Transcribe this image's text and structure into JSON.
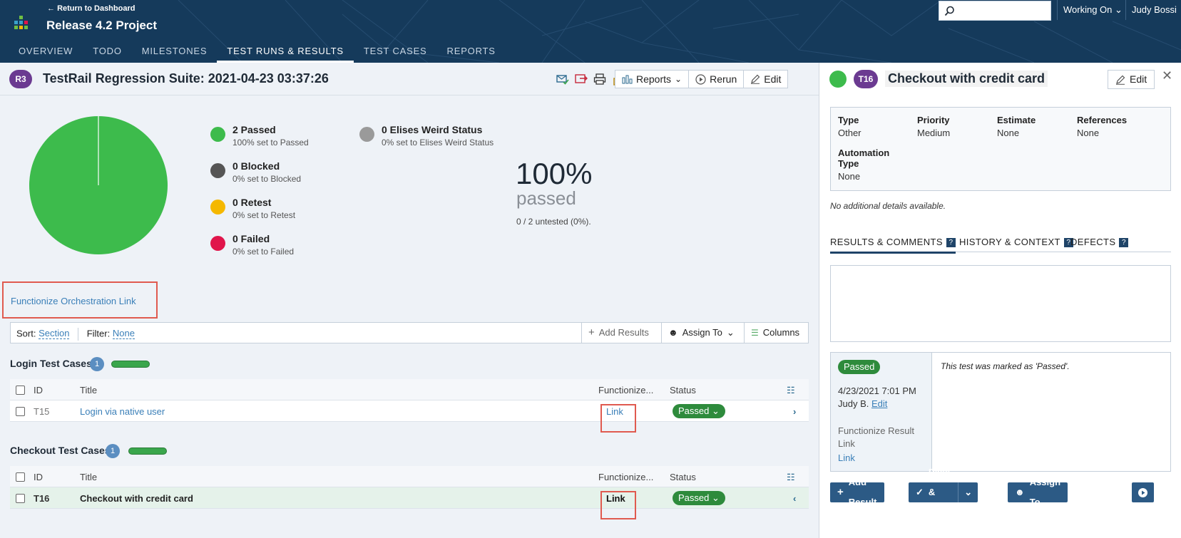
{
  "header": {
    "back_label": "Return to Dashboard",
    "project_title": "Release 4.2 Project",
    "tabs": [
      "OVERVIEW",
      "TODO",
      "MILESTONES",
      "TEST RUNS & RESULTS",
      "TEST CASES",
      "REPORTS"
    ],
    "active_tab": "TEST RUNS & RESULTS",
    "search_placeholder": "",
    "working_on_label": "Working On",
    "user_name": "Judy Bossi"
  },
  "run": {
    "badge": "R3",
    "title": "TestRail Regression Suite: 2021-04-23 03:37:26",
    "reports_label": "Reports",
    "rerun_label": "Rerun",
    "edit_label": "Edit"
  },
  "summary": {
    "legend": [
      {
        "label": "2 Passed",
        "sub": "100% set to Passed",
        "color": "#3dbb4c"
      },
      {
        "label": "0 Blocked",
        "sub": "0% set to Blocked",
        "color": "#555555"
      },
      {
        "label": "0 Retest",
        "sub": "0% set to Retest",
        "color": "#f5b800"
      },
      {
        "label": "0 Failed",
        "sub": "0% set to Failed",
        "color": "#e0154b"
      },
      {
        "label": "0 Elises Weird Status",
        "sub": "0% set to Elises Weird Status",
        "color": "#9a9a9a"
      }
    ],
    "percent": "100%",
    "percent_label": "passed",
    "untested": "0 / 2 untested (0%).",
    "pie_passed_fraction": 1.0
  },
  "orchestration_link": "Functionize Orchestration Link",
  "toolbar": {
    "sort_label": "Sort:",
    "sort_value": "Section",
    "filter_label": "Filter:",
    "filter_value": "None",
    "add_results": "Add Results",
    "assign_to": "Assign To",
    "columns": "Columns"
  },
  "sections": [
    {
      "title": "Login Test Cases",
      "count": "1",
      "columns": {
        "id": "ID",
        "title": "Title",
        "fn": "Functionize...",
        "status": "Status"
      },
      "rows": [
        {
          "id": "T15",
          "title": "Login via native user",
          "link": "Link",
          "status": "Passed"
        }
      ]
    },
    {
      "title": "Checkout Test Cases",
      "count": "1",
      "columns": {
        "id": "ID",
        "title": "Title",
        "fn": "Functionize...",
        "status": "Status"
      },
      "rows": [
        {
          "id": "T16",
          "title": "Checkout with credit card",
          "link": "Link",
          "status": "Passed"
        }
      ]
    }
  ],
  "detail": {
    "badge": "T16",
    "title": "Checkout with credit card",
    "edit_label": "Edit",
    "fields": {
      "type_k": "Type",
      "type_v": "Other",
      "priority_k": "Priority",
      "priority_v": "Medium",
      "estimate_k": "Estimate",
      "estimate_v": "None",
      "references_k": "References",
      "references_v": "None",
      "automation_k1": "Automation",
      "automation_k2": "Type",
      "automation_v": "None"
    },
    "no_details": "No additional details available.",
    "tabs": [
      "RESULTS & COMMENTS",
      "HISTORY & CONTEXT",
      "DEFECTS"
    ],
    "result": {
      "status": "Passed",
      "date": "4/23/2021 7:01 PM",
      "user": "Judy B.",
      "edit_label": "Edit",
      "fn_label_1": "Functionize Result",
      "fn_label_2": "Link",
      "fn_link": "Link",
      "comment": "This test was marked as 'Passed'."
    },
    "actions": {
      "add_result": "Add Result",
      "pass_next": "Pass & Next",
      "assign_to": "Assign To"
    }
  }
}
